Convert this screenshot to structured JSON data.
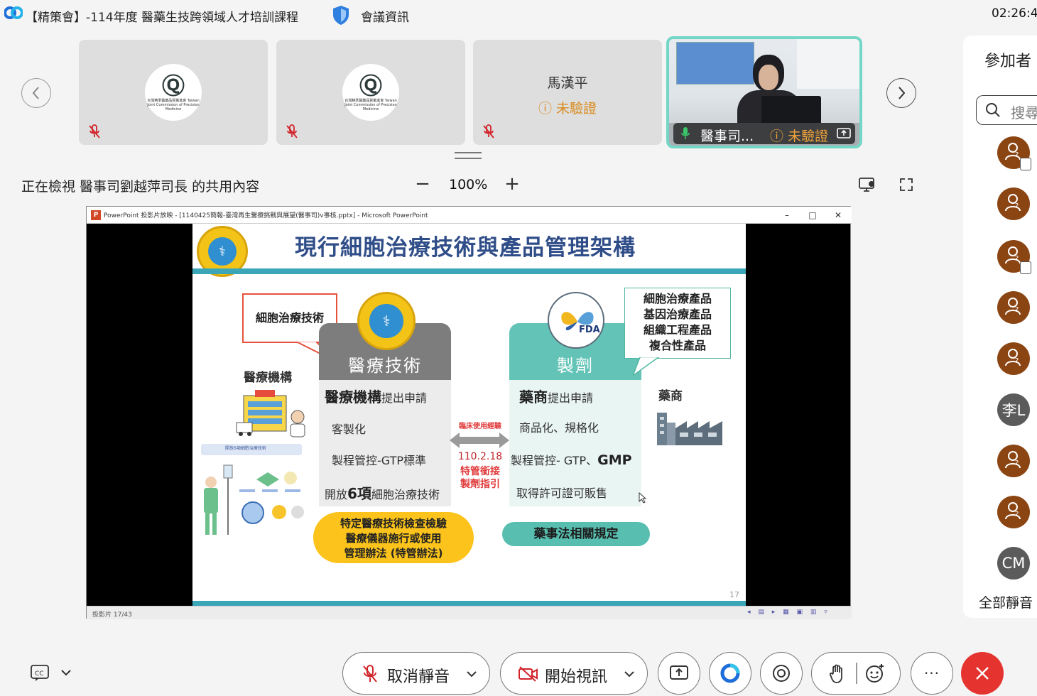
{
  "window": {
    "meeting_title": "【精策會】-114年度 醫藥生技跨領域人才培訓課程",
    "meeting_info_label": "會議資訊",
    "clock": "02:26:45"
  },
  "video_strip": {
    "tiles": [
      {
        "logo_text": "台灣精準醫藥品質策進會 Taiwan Joint Commission of Precision Medicine"
      },
      {
        "logo_text": "台灣精準醫藥品質策進會 Taiwan Joint Commission of Precision Medicine"
      },
      {
        "name": "馬漢平",
        "status": "未驗證"
      },
      {
        "name": "醫事司...",
        "status": "未驗證"
      }
    ]
  },
  "share_bar": {
    "label": "正在檢視 醫事司劉越萍司長 的共用內容",
    "zoom_minus": "−",
    "zoom_level": "100%",
    "zoom_plus": "+"
  },
  "ppt": {
    "window_title": "PowerPoint 投影片放映 - [1140425簡報-臺灣再生醫療挑戰與展望(醫事司)v事核.pptx] - Microsoft PowerPoint",
    "slide_counter": "投影片 17/43",
    "slide": {
      "title": "現行細胞治療技術與產品管理架構",
      "page_number": "17",
      "callout_left": "細胞治療技術",
      "callout_right_lines": [
        "細胞治療產品",
        "基因治療產品",
        "組織工程產品",
        "複合性產品"
      ],
      "left_side_label": "醫療機構",
      "right_side_label": "藥商",
      "fda_label": "FDA",
      "left_panel": {
        "header": "醫療技術",
        "line1_bold": "醫療機構",
        "line1_rest": "提出申請",
        "line2": "客製化",
        "line3": "製程管控-GTP標準",
        "line4_pre": "開放",
        "line4_bold": "6項",
        "line4_post": "細胞治療技術"
      },
      "right_panel": {
        "header": "製劑",
        "line1_bold": "藥商",
        "line1_rest": "提出申請",
        "line2": "商品化、規格化",
        "line3_pre": "製程管控- GTP、",
        "line3_bold": "GMP",
        "line4": "取得許可證可販售"
      },
      "middle": {
        "top_label": "臨床使用經驗",
        "date": "110.2.18",
        "line2": "特管銜接",
        "line3": "製劑指引"
      },
      "pill_left_lines": [
        "特定醫療技術檢查檢驗",
        "醫療儀器施行或使用",
        "管理辦法 (特管辦法)"
      ],
      "pill_right": "藥事法相關規定",
      "thumb_caption": "開放6項細胞治療技術"
    }
  },
  "sidebar": {
    "title": "參加者",
    "search_placeholder": "搜尋",
    "avatars": [
      {
        "type": "icon",
        "device": true
      },
      {
        "type": "icon",
        "device": false
      },
      {
        "type": "icon",
        "device": true
      },
      {
        "type": "icon",
        "device": false
      },
      {
        "type": "icon",
        "device": false
      },
      {
        "type": "initials",
        "text": "李L"
      },
      {
        "type": "icon",
        "device": false
      },
      {
        "type": "icon",
        "device": false
      },
      {
        "type": "initials",
        "text": "CM"
      }
    ],
    "mute_all": "全部靜音"
  },
  "controls": {
    "unmute_label": "取消靜音",
    "start_video_label": "開始視訊",
    "more_label": "···"
  },
  "colors": {
    "accent_teal": "#62c3b6",
    "slide_title": "#2f4d88",
    "end_call": "#e5342f",
    "unverified": "#d98a1c"
  }
}
